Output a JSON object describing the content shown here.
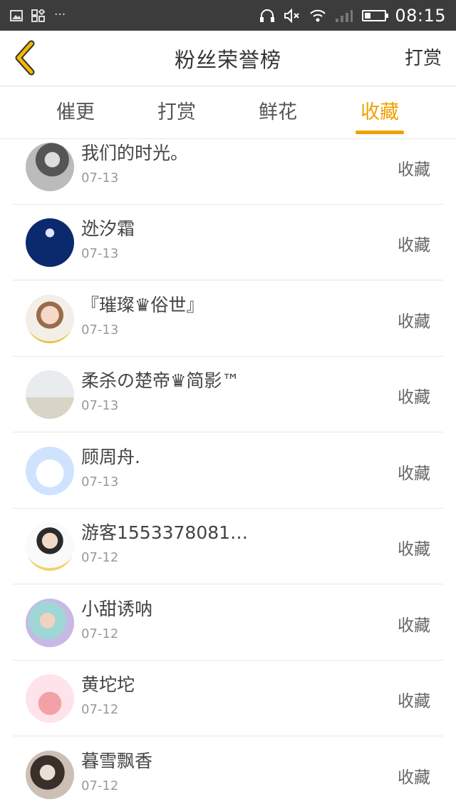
{
  "status_bar": {
    "left_icons": [
      "image-icon",
      "apps-icon",
      "more-icon"
    ],
    "right_icons": [
      "headphones-icon",
      "mute-icon",
      "wifi-icon",
      "signal-icon",
      "battery-icon"
    ],
    "more_text": "···",
    "time": "08:15",
    "battery_level": 0.3
  },
  "header": {
    "title": "粉丝荣誉榜",
    "right_action": "打赏",
    "accent_color": "#f0a000"
  },
  "tabs": [
    {
      "label": "催更",
      "active": false
    },
    {
      "label": "打赏",
      "active": false
    },
    {
      "label": "鲜花",
      "active": false
    },
    {
      "label": "收藏",
      "active": true
    }
  ],
  "list": [
    {
      "name": "我们的时光。",
      "date": "07-13",
      "action": "收藏"
    },
    {
      "name": "迯汐霜",
      "date": "07-13",
      "action": "收藏"
    },
    {
      "name": "『璀璨♛俗世』",
      "date": "07-13",
      "action": "收藏"
    },
    {
      "name": "柔杀の楚帝♛简影™",
      "date": "07-13",
      "action": "收藏"
    },
    {
      "name": "顾周舟.",
      "date": "07-13",
      "action": "收藏"
    },
    {
      "name": "游客1553378081…",
      "date": "07-12",
      "action": "收藏"
    },
    {
      "name": "小甜诱呐",
      "date": "07-12",
      "action": "收藏"
    },
    {
      "name": "黄坨坨",
      "date": "07-12",
      "action": "收藏"
    },
    {
      "name": "暮雪飘香",
      "date": "07-12",
      "action": "收藏"
    }
  ]
}
